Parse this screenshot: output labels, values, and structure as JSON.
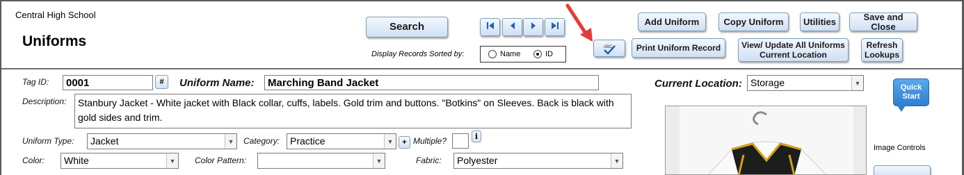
{
  "header": {
    "school": "Central High School",
    "title": "Uniforms",
    "search_label": "Search",
    "sort_label": "Display Records Sorted by:",
    "sort_options": [
      "Name",
      "ID"
    ],
    "sort_selected": "ID",
    "buttons": {
      "add": "Add Uniform",
      "copy": "Copy Uniform",
      "utilities": "Utilities",
      "save_close": "Save and Close",
      "spell_icon_text": "ABC",
      "print": "Print Uniform Record",
      "view_update": "View/ Update All Uniforms Current Location",
      "refresh": "Refresh Lookups"
    }
  },
  "form": {
    "tag_label": "Tag ID:",
    "tag_value": "0001",
    "hash": "#",
    "name_label": "Uniform Name:",
    "name_value": "Marching Band Jacket",
    "location_label": "Current Location:",
    "location_value": "Storage",
    "desc_label": "Description:",
    "desc_value": "Stanbury Jacket - White jacket with Black collar, cuffs, labels.  Gold trim and buttons.  \"Botkins\" on Sleeves.  Back is black with gold sides and trim.",
    "type_label": "Uniform Type:",
    "type_value": "Jacket",
    "category_label": "Category:",
    "category_value": "Practice",
    "plus": "+",
    "multiple_label": "Multiple?",
    "info": "i",
    "color_label": "Color:",
    "color_value": "White",
    "pattern_label": "Color Pattern:",
    "pattern_value": "",
    "fabric_label": "Fabric:",
    "fabric_value": "Polyester",
    "quick_start": "Quick Start",
    "image_controls": "Image Controls"
  },
  "colors": {
    "accent": "#2f7fd0",
    "arrow": "#e53935",
    "button_bg": "#dbe7f5"
  }
}
